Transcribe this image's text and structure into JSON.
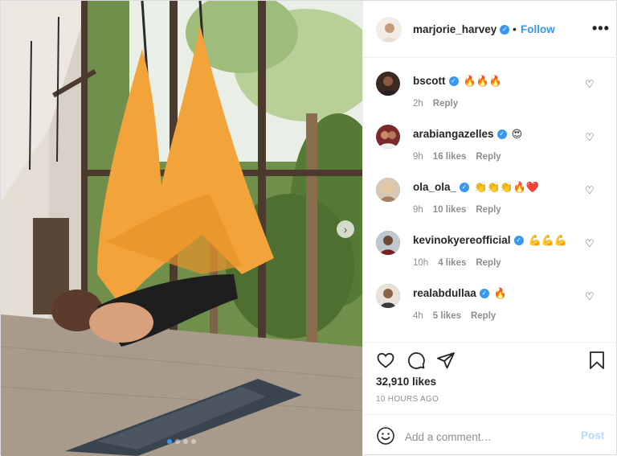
{
  "post": {
    "author": "marjorie_harvey",
    "verified": true,
    "bullet": "•",
    "follow_label": "Follow",
    "more_label": "•••",
    "likes_text": "32,910 likes",
    "time_ago": "10 HOURS AGO"
  },
  "media": {
    "next_icon": "chevron-right-icon",
    "carousel_dots": 4,
    "active_dot": 0
  },
  "comments": [
    {
      "username": "bscott",
      "verified": true,
      "text": "🔥🔥🔥",
      "time": "2h",
      "likes": "",
      "reply": "Reply",
      "avatar_color": "#3a2a22"
    },
    {
      "username": "arabiangazelles",
      "verified": true,
      "text": "😍",
      "time": "9h",
      "likes": "16 likes",
      "reply": "Reply",
      "avatar_color": "#7a2a2a"
    },
    {
      "username": "ola_ola_",
      "verified": true,
      "text": "👏👏👏🔥❤️",
      "time": "9h",
      "likes": "10 likes",
      "reply": "Reply",
      "avatar_color": "#b99a7a"
    },
    {
      "username": "kevinokyereofficial",
      "verified": true,
      "text": "💪💪💪",
      "time": "10h",
      "likes": "4 likes",
      "reply": "Reply",
      "avatar_color": "#6b5040"
    },
    {
      "username": "realabdullaa",
      "verified": true,
      "text": "🔥",
      "time": "4h",
      "likes": "5 likes",
      "reply": "Reply",
      "avatar_color": "#5a4a40"
    }
  ],
  "add_comment": {
    "placeholder": "Add a comment…",
    "post_label": "Post"
  },
  "colors": {
    "accent": "#3897f0",
    "post_disabled": "#b3dbff",
    "meta_gray": "#8e8e8e",
    "hammock_orange": "#f2a33a"
  }
}
